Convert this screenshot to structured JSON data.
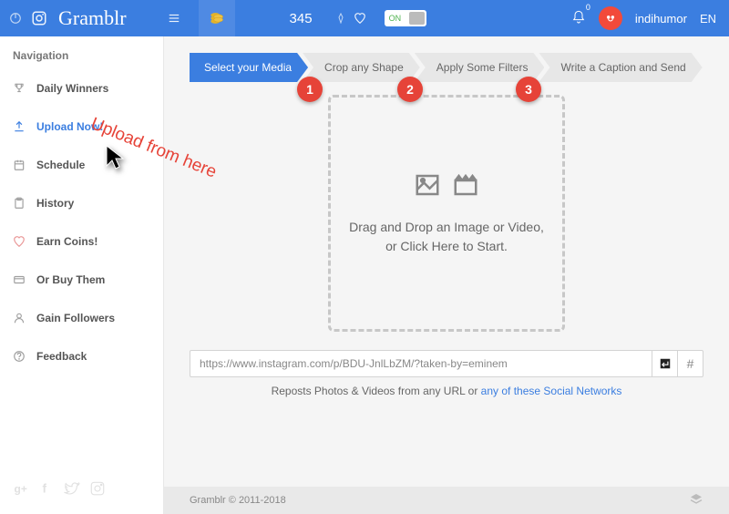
{
  "header": {
    "app_name": "Gramblr",
    "coins": "345",
    "toggle_label": "ON",
    "notification_count": "0",
    "username": "indihumor",
    "language": "EN"
  },
  "sidebar": {
    "title": "Navigation",
    "items": [
      {
        "label": "Daily Winners",
        "icon": "trophy"
      },
      {
        "label": "Upload Now!",
        "icon": "upload",
        "active": true
      },
      {
        "label": "Schedule",
        "icon": "calendar"
      },
      {
        "label": "History",
        "icon": "history"
      },
      {
        "label": "Earn Coins!",
        "icon": "heart"
      },
      {
        "label": "Or Buy Them",
        "icon": "card"
      },
      {
        "label": "Gain Followers",
        "icon": "user"
      },
      {
        "label": "Feedback",
        "icon": "help"
      }
    ]
  },
  "steps": [
    "Select your Media",
    "Crop any Shape",
    "Apply Some Filters",
    "Write a Caption and Send"
  ],
  "dropzone": {
    "line1": "Drag and Drop an Image or Video,",
    "line2": "or Click Here to Start."
  },
  "url_input": {
    "value": "https://www.instagram.com/p/BDU-JnlLbZM/?taken-by=eminem"
  },
  "repost": {
    "prefix": "Reposts Photos & Videos from any URL or ",
    "link": "any of these Social Networks"
  },
  "footer": {
    "copyright": "Gramblr © 2011-2018"
  },
  "annotations": {
    "text": "Upload from here",
    "circles": [
      "1",
      "2",
      "3"
    ]
  }
}
